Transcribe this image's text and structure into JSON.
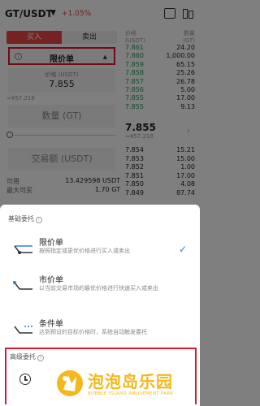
{
  "header": {
    "pair": "GT/USDT",
    "change": "+1.05%",
    "icons": [
      "chart-icon",
      "candlestick-icon"
    ]
  },
  "trade": {
    "buy_tab": "买入",
    "sell_tab": "卖出",
    "order_type": "限价单",
    "price_caption": "价格 (USDT)",
    "price_value": "7.855",
    "approx": "≈¥57.218",
    "qty_placeholder": "数量 (GT)",
    "amount_placeholder": "交易额 (USDT)",
    "available_label": "可用",
    "available_value": "13.429598 USDT",
    "max_buy_label": "最大可买",
    "max_buy_value": "1.70 GT"
  },
  "orderbook": {
    "col_price": "价格",
    "col_price_unit": "(USDT)",
    "col_qty": "数量",
    "col_qty_unit": "(GT)",
    "bids_top": [
      {
        "price": "7.861",
        "qty": "24.20"
      },
      {
        "price": "7.860",
        "qty": "1,000.00"
      },
      {
        "price": "7.859",
        "qty": "65.15"
      },
      {
        "price": "7.858",
        "qty": "25.26"
      },
      {
        "price": "7.857",
        "qty": "26.78"
      },
      {
        "price": "7.856",
        "qty": "5.00"
      },
      {
        "price": "7.855",
        "qty": "17.00"
      },
      {
        "price": "7.855",
        "qty": "9.13"
      }
    ],
    "last_price": "7.855",
    "last_cny": "≈¥57.218",
    "asks": [
      {
        "price": "7.854",
        "qty": "15.21"
      },
      {
        "price": "7.853",
        "qty": "15.00"
      },
      {
        "price": "7.852",
        "qty": "1.00"
      },
      {
        "price": "7.851",
        "qty": "17.00"
      },
      {
        "price": "7.850",
        "qty": "4.08"
      },
      {
        "price": "7.849",
        "qty": "87.74"
      }
    ]
  },
  "sheet": {
    "basic_title": "基础委托",
    "options": [
      {
        "name": "限价单",
        "desc": "按照指定或更优价格进行买入或卖出"
      },
      {
        "name": "市价单",
        "desc": "以当前交易市场的最优价格进行快速买入或卖出"
      },
      {
        "name": "条件单",
        "desc": "达到预设的目标价格时，系统自动触发委托"
      }
    ],
    "advanced_title": "高级委托"
  },
  "watermark": {
    "title": "泡泡岛乐园",
    "subtitle": "BUBBLE ISLAND AMUSEMENT PARK"
  },
  "colors": {
    "buy": "#e84545",
    "bid": "#1e9e52",
    "ask": "#e03c3c",
    "highlight_border": "#e0192e",
    "check": "#3b78e7",
    "watermark": "#f4b81c"
  }
}
